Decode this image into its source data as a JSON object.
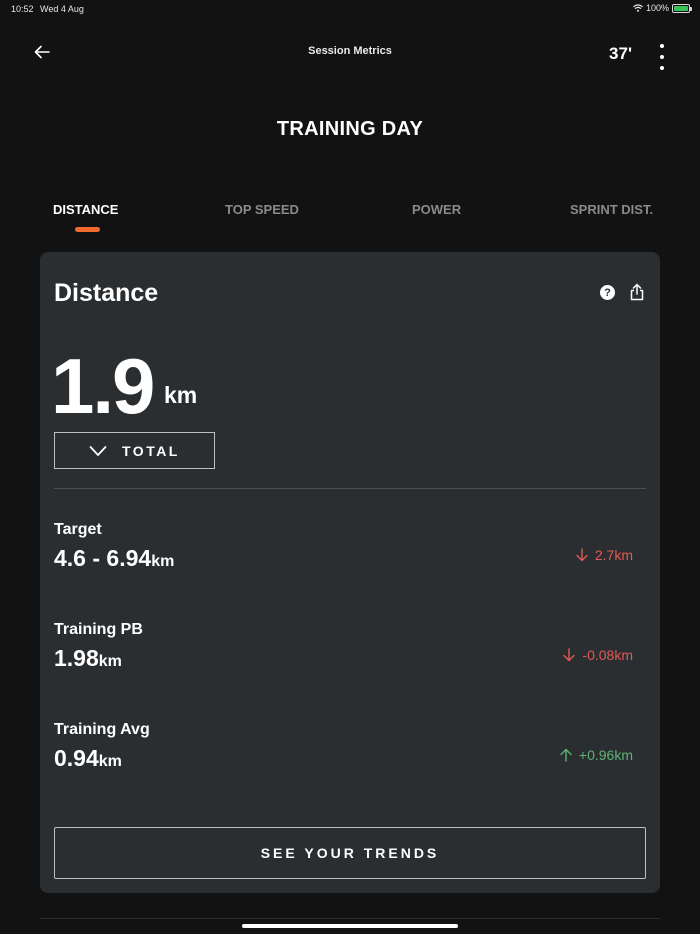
{
  "status_bar": {
    "time": "10:52",
    "date": "Wed 4 Aug",
    "battery": "100%"
  },
  "nav": {
    "title": "Session Metrics",
    "duration": "37'"
  },
  "page_title": "TRAINING DAY",
  "tabs": [
    {
      "label": "DISTANCE",
      "active": true
    },
    {
      "label": "TOP SPEED",
      "active": false
    },
    {
      "label": "POWER",
      "active": false
    },
    {
      "label": "SPRINT DIST.",
      "active": false
    }
  ],
  "card": {
    "title": "Distance",
    "value": "1.9",
    "unit": "km",
    "aggregation": "TOTAL",
    "metrics": [
      {
        "label": "Target",
        "value": "4.6 - 6.94",
        "unit": "km",
        "diff": "2.7km",
        "direction": "down"
      },
      {
        "label": "Training PB",
        "value": "1.98",
        "unit": "km",
        "diff": "-0.08km",
        "direction": "down"
      },
      {
        "label": "Training Avg",
        "value": "0.94",
        "unit": "km",
        "diff": "+0.96km",
        "direction": "up"
      }
    ],
    "trends_button": "SEE YOUR TRENDS"
  },
  "colors": {
    "accent": "#f26a2d",
    "negative": "#e05a55",
    "positive": "#5fb175",
    "card_bg": "#2b2e31",
    "page_bg": "#121212"
  },
  "icons": [
    "back-arrow-icon",
    "more-icon",
    "help-icon",
    "share-icon",
    "chevron-down-icon",
    "arrow-down-icon",
    "arrow-up-icon",
    "wifi-icon",
    "battery-icon"
  ]
}
